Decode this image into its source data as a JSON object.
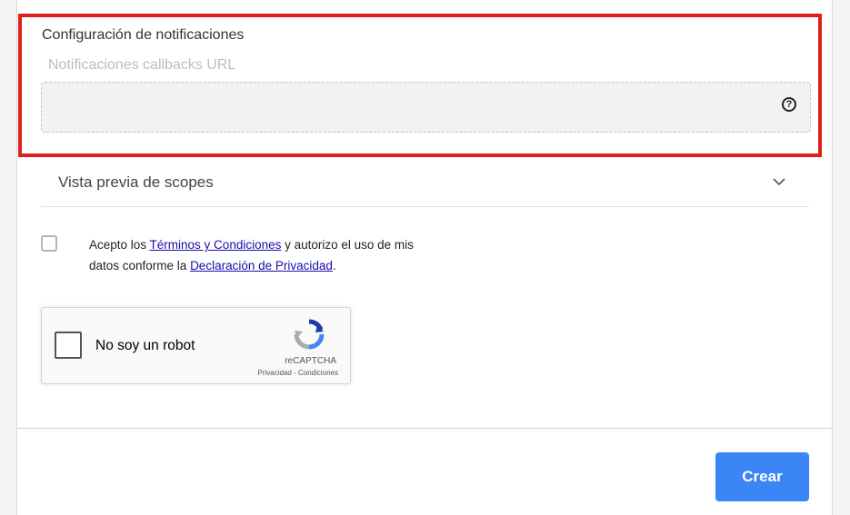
{
  "notifications": {
    "section_title": "Configuración de notificaciones",
    "callback_label": "Notificaciones callbacks URL",
    "callback_value": "",
    "help_icon": "question-circle-icon",
    "highlight_color": "#e0201c"
  },
  "scopes": {
    "label": "Vista previa de scopes",
    "toggle_icon": "chevron-down-icon"
  },
  "terms": {
    "text_1": "Acepto los ",
    "terms_link": "Términos y Condiciones",
    "text_2": " y autorizo el uso de mis datos conforme la ",
    "privacy_link": "Declaración de Privacidad",
    "text_3": "."
  },
  "recaptcha": {
    "label": "No soy un robot",
    "brand": "reCAPTCHA",
    "privacy": "Privacidad",
    "separator": " - ",
    "conditions": "Condiciones"
  },
  "actions": {
    "create_label": "Crear",
    "accent_color": "#3b86f7"
  }
}
